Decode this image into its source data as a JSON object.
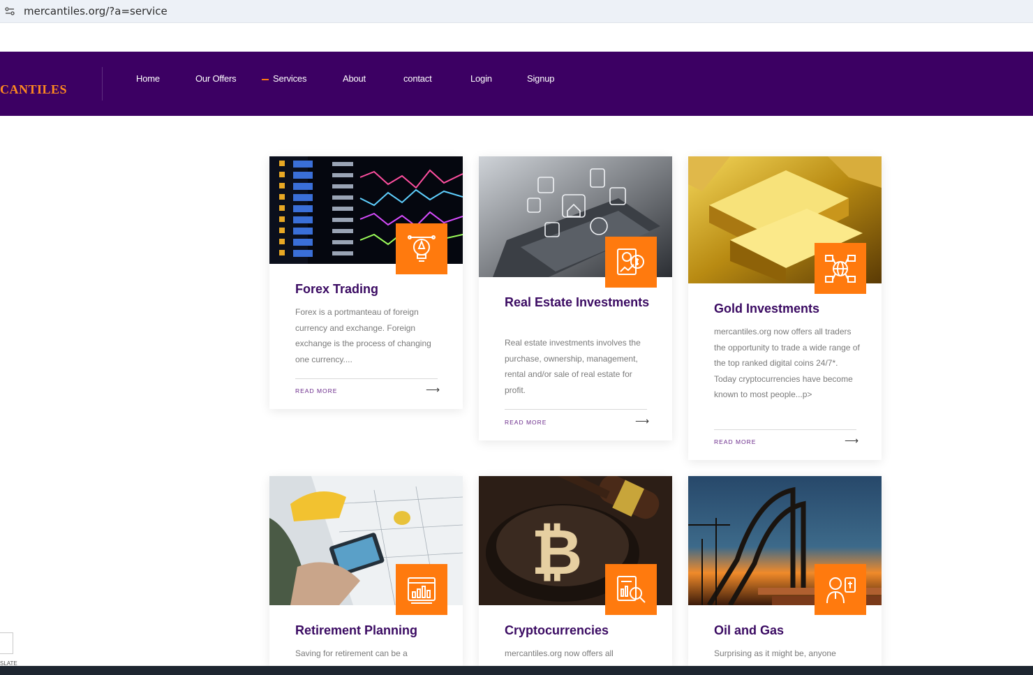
{
  "browser": {
    "url": "mercantiles.org/?a=service"
  },
  "brand": {
    "logo_text": "CANTILES",
    "accent": "#ff7a0e",
    "nav_bg": "#3c0063"
  },
  "menu": [
    {
      "label": "Home"
    },
    {
      "label": "Our Offers"
    },
    {
      "label": "Services"
    },
    {
      "label": "About"
    },
    {
      "label": "contact"
    },
    {
      "label": "Login"
    },
    {
      "label": "Signup"
    }
  ],
  "cards": [
    {
      "title": "Forex Trading",
      "desc": "Forex is a portmanteau of foreign currency and exchange. Foreign exchange is the process of changing one currency....",
      "read_more": "READ MORE",
      "icon": "lightbulb-pen-icon"
    },
    {
      "title": "Real Estate Investments",
      "desc": "Real estate investments involves the purchase, ownership, management, rental and/or sale of real estate for profit.",
      "read_more": "READ MORE",
      "icon": "money-growth-icon"
    },
    {
      "title": "Gold Investments",
      "desc": "mercantiles.org now offers all traders the opportunity to trade a wide range of the top ranked digital coins 24/7*. Today cryptocurrencies have become known to most people...p>",
      "read_more": "READ MORE",
      "icon": "global-network-icon"
    },
    {
      "title": "Retirement Planning",
      "desc": "Saving for retirement can be a",
      "icon": "browser-chart-icon"
    },
    {
      "title": "Cryptocurrencies",
      "desc": "mercantiles.org now offers all",
      "icon": "report-magnifier-icon"
    },
    {
      "title": "Oil and Gas",
      "desc": "Surprising as it might be, anyone",
      "icon": "businessman-icon"
    }
  ],
  "translate_label": "SLATE"
}
